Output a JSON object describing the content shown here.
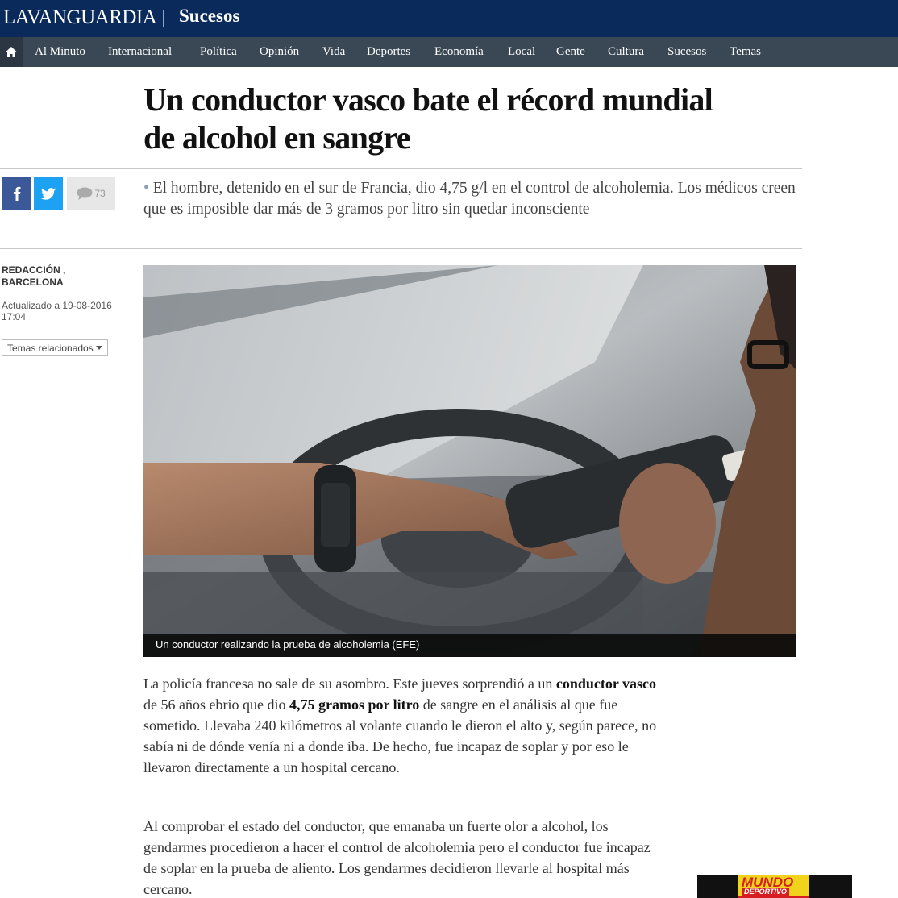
{
  "header": {
    "logo": "LAVANGUARDIA",
    "section": "Sucesos"
  },
  "nav": {
    "home_icon": "home-icon",
    "items": [
      "Al Minuto",
      "Internacional",
      "Política",
      "Opinión",
      "Vida",
      "Deportes",
      "Economía",
      "Local",
      "Gente",
      "Cultura",
      "Sucesos",
      "Temas"
    ]
  },
  "article": {
    "headline_line1": "Un conductor vasco bate el récord mundial",
    "headline_line2": "de alcohol en sangre",
    "subtitle_bullet": "•",
    "subtitle": "El hombre, detenido en el sur de Francia, dio 4,75 g/l en el control de alcoholemia. Los médicos creen que es imposible dar más de 3 gramos por litro sin quedar inconsciente",
    "byline": "REDACCIÓN , BARCELONA",
    "updated": "Actualizado a 19-08-2016 17:04",
    "topics_label": "Temas relacionados",
    "photo_caption": "Un conductor realizando la prueba de alcoholemia (EFE)",
    "p1_a": "La policía francesa no sale de su asombro. Este jueves sorprendió a un ",
    "p1_b": "conductor vasco",
    "p1_c": " de 56 años ebrio que dio ",
    "p1_d": "4,75 gramos por litro",
    "p1_e": " de sangre en el análisis al que fue sometido. Llevaba 240 kilómetros al volante cuando le dieron el alto y, según parece, no sabía ni de dónde venía ni a donde iba. De hecho, fue incapaz de soplar y por eso le llevaron directamente a un hospital cercano.",
    "p2": "Al comprobar el estado del conductor, que emanaba un fuerte olor a alcohol, los gendarmes procedieron a hacer el control de alcoholemia pero el conductor fue incapaz de soplar en la prueba de aliento. Los gendarmes decidieron llevarle al hospital más cercano."
  },
  "share": {
    "facebook_icon": "facebook-icon",
    "twitter_icon": "twitter-icon",
    "comment_icon": "comment-icon",
    "comment_count": "73"
  },
  "ad": {
    "brand": "MUNDO",
    "sub": "DEPORTIVO"
  },
  "colors": {
    "topbar": "#0b2a5c",
    "navbar": "#3a4754",
    "facebook": "#3b5998",
    "twitter": "#1da1f2"
  }
}
